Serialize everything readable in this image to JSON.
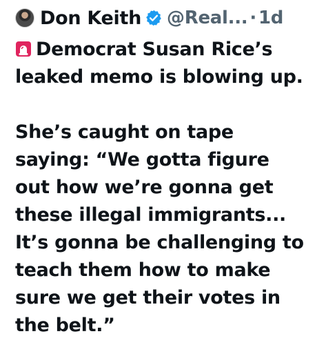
{
  "post": {
    "author": {
      "display_name": "Don Keith",
      "handle": "@Real...",
      "verified_icon": "verified-badge-icon",
      "avatar_icon": "profile-photo"
    },
    "separator": "·",
    "time": "1d",
    "siren_icon": "police-siren-icon",
    "line1": "Democrat Susan Rice’s",
    "line2": "leaked memo is blowing up.",
    "line3": "She’s caught on tape",
    "line4": "saying: “We gotta figure",
    "line5": "out how we’re gonna get",
    "line6": "these illegal immigrants...",
    "line7": "It’s gonna be challenging to",
    "line8": "teach them how to make",
    "line9": "sure we get their votes in",
    "line10": "the belt.”"
  },
  "colors": {
    "text": "#0f1419",
    "secondary": "#536471",
    "verified": "#1d9bf0",
    "siren": "#e0245e"
  }
}
